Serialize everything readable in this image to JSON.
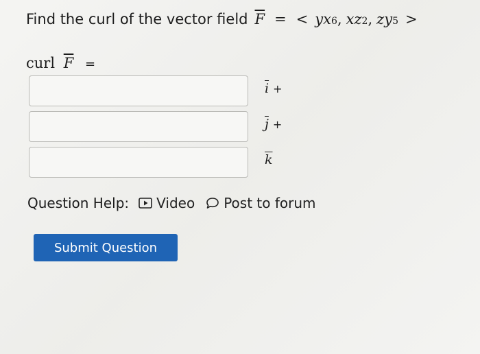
{
  "question": {
    "prefix": "Find the curl of the vector field",
    "field_symbol": "F",
    "equals": "=",
    "open": "<",
    "comp1_base": "yx",
    "comp1_exp": "6",
    "sep1": ",",
    "comp2_base": "xz",
    "comp2_exp": "2",
    "sep2": ",",
    "comp3_base": "zy",
    "comp3_exp": "5",
    "close": ">"
  },
  "curl": {
    "word": "curl",
    "symbol": "F",
    "equals": "="
  },
  "answers": [
    {
      "unit": "i",
      "plus": "+",
      "value": ""
    },
    {
      "unit": "j",
      "plus": "+",
      "value": ""
    },
    {
      "unit": "k",
      "plus": "",
      "value": ""
    }
  ],
  "help": {
    "label": "Question Help:",
    "video_label": "Video",
    "video_icon": "play-icon",
    "forum_label": "Post to forum",
    "forum_icon": "speech-bubble-icon"
  },
  "submit": {
    "label": "Submit Question",
    "color": "#1f64b5"
  }
}
